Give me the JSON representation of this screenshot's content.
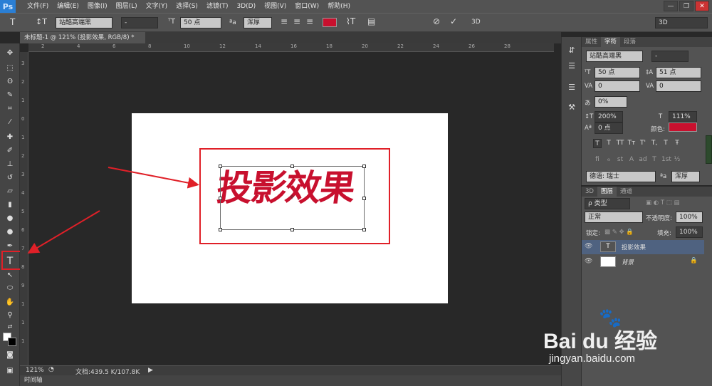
{
  "app": {
    "logo": "Ps"
  },
  "menu": [
    "文件(F)",
    "编辑(E)",
    "图像(I)",
    "图层(L)",
    "文字(Y)",
    "选择(S)",
    "滤镜(T)",
    "3D(D)",
    "视图(V)",
    "窗口(W)",
    "帮助(H)"
  ],
  "window_controls": {
    "minimize": "—",
    "restore": "❐",
    "close": "✕"
  },
  "options": {
    "tool_glyph": "T",
    "font_family": "站酷高端黑",
    "font_style": "-",
    "font_size": "50 点",
    "aa_label": "ªa",
    "antialias": "浑厚",
    "text_color": "#c8102e",
    "workspace": "3D",
    "three_d": "3D"
  },
  "document": {
    "tab_title": "未标题-1 @ 121% (投影效果, RGB/8) *",
    "tab_close": "×",
    "text": "投影效果",
    "text_color": "#c8102e"
  },
  "ruler_h": [
    "2",
    "4",
    "6",
    "8",
    "10",
    "12",
    "14",
    "16",
    "18",
    "20",
    "22",
    "24",
    "26",
    "28"
  ],
  "ruler_v": [
    "3",
    "2",
    "1",
    "0",
    "1",
    "2",
    "3",
    "4",
    "5",
    "6",
    "7",
    "8",
    "9",
    "1",
    "1",
    "1"
  ],
  "status": {
    "zoom": "121%",
    "doc_info": "文档:439.5 K/107.8K",
    "arrow": "▶"
  },
  "timeline": "时间轴",
  "char_panel": {
    "tabs": [
      "属性",
      "字符",
      "段落"
    ],
    "font_family": "站酷高端黑",
    "font_style": "-",
    "font_size": "50 点",
    "leading": "51 点",
    "kerning": "0",
    "tracking": "0",
    "tsume": "0%",
    "vscale": "200%",
    "hscale": "111%",
    "baseline": "0 点",
    "color_label": "颜色:",
    "color": "#c8102e",
    "glyphs1": [
      "T",
      "T",
      "TT",
      "Tт",
      "T'",
      "T,",
      "T",
      "Ŧ"
    ],
    "glyphs2": [
      "ﬁ",
      "ℴ",
      "st",
      "A",
      "ad",
      "T",
      "1st",
      "½"
    ],
    "language": "德语: 瑞士",
    "aa_label": "ªa",
    "antialias": "浑厚"
  },
  "layers_panel": {
    "tabs": [
      "3D",
      "图层",
      "通道"
    ],
    "filter": "ρ 类型",
    "blend": "正常",
    "opacity_label": "不透明度:",
    "opacity": "100%",
    "lock_label": "锁定:",
    "fill_label": "填充:",
    "fill": "100%",
    "layers": [
      {
        "name": "投影效果",
        "type": "text",
        "thumb": "T"
      },
      {
        "name": "背景",
        "type": "bg"
      }
    ]
  },
  "watermark": {
    "brand": "Bai du 经验",
    "url": "jingyan.baidu.com"
  }
}
